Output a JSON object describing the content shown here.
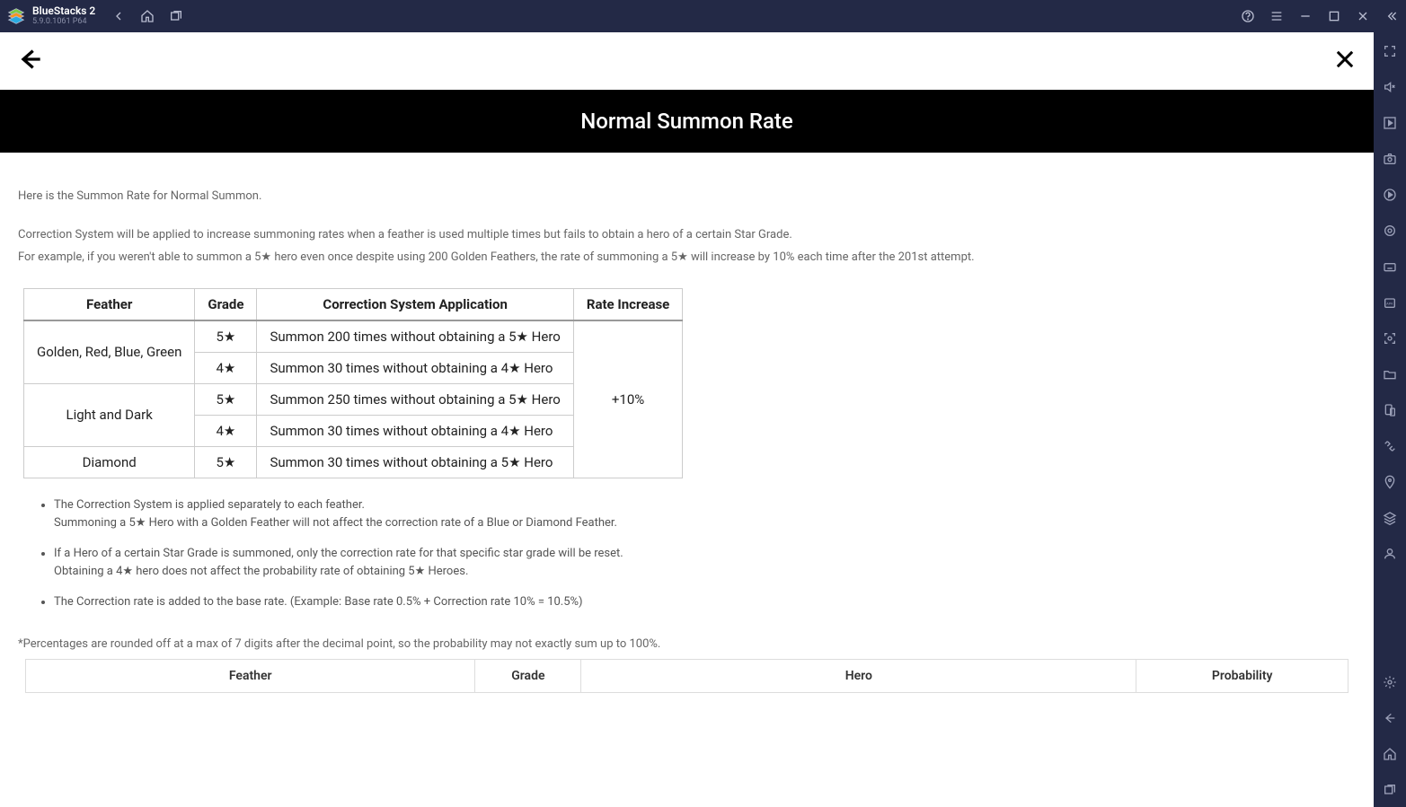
{
  "titlebar": {
    "app_name": "BlueStacks 2",
    "version": "5.9.0.1061 P64"
  },
  "banner_title": "Normal Summon Rate",
  "intro_line": "Here is the Summon Rate for Normal Summon.",
  "correction_intro_1": "Correction System will be applied to increase summoning rates when a feather is used multiple times but fails to obtain a hero of a certain Star Grade.",
  "correction_intro_2": "For example, if you weren't able to summon a 5★ hero even once despite using 200 Golden Feathers, the rate of summoning a 5★ will increase by 10% each time after the 201st attempt.",
  "correction_table": {
    "headers": {
      "feather": "Feather",
      "grade": "Grade",
      "application": "Correction System Application",
      "rate": "Rate Increase"
    },
    "rate_increase": "+10%",
    "groups": [
      {
        "feather": "Golden, Red, Blue, Green",
        "rows": [
          {
            "grade": "5★",
            "application": "Summon 200 times without obtaining a 5★ Hero"
          },
          {
            "grade": "4★",
            "application": "Summon 30 times without obtaining a 4★ Hero"
          }
        ]
      },
      {
        "feather": "Light and Dark",
        "rows": [
          {
            "grade": "5★",
            "application": "Summon 250 times without obtaining a 5★ Hero"
          },
          {
            "grade": "4★",
            "application": "Summon 30 times without obtaining a 4★ Hero"
          }
        ]
      },
      {
        "feather": "Diamond",
        "rows": [
          {
            "grade": "5★",
            "application": "Summon 30 times without obtaining a 5★ Hero"
          }
        ]
      }
    ]
  },
  "bullets": [
    {
      "line1": "The Correction System is applied separately to each feather.",
      "line2": "Summoning a 5★ Hero with a Golden Feather will not affect the correction rate of a Blue or Diamond Feather."
    },
    {
      "line1": "If a Hero of a certain Star Grade is summoned, only the correction rate for that specific star grade will be reset.",
      "line2": "Obtaining a 4★ hero does not affect the probability rate of obtaining 5★ Heroes."
    },
    {
      "line1": "The Correction rate is added to the base rate. (Example: Base rate 0.5% + Correction rate 10% = 10.5%)"
    }
  ],
  "footnote": "*Percentages are rounded off at a max of 7 digits after the decimal point, so the probability may not exactly sum up to 100%.",
  "rate_table": {
    "headers": {
      "feather": "Feather",
      "grade": "Grade",
      "hero": "Hero",
      "probability": "Probability"
    }
  }
}
